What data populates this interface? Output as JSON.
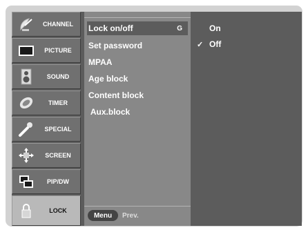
{
  "categories": [
    {
      "label": "CHANNEL",
      "icon": "satellite-dish-icon",
      "selected": false
    },
    {
      "label": "PICTURE",
      "icon": "tv-screen-icon",
      "selected": false
    },
    {
      "label": "SOUND",
      "icon": "speaker-icon",
      "selected": false
    },
    {
      "label": "TIMER",
      "icon": "clock-icon",
      "selected": false
    },
    {
      "label": "SPECIAL",
      "icon": "special-wand-icon",
      "selected": false
    },
    {
      "label": "SCREEN",
      "icon": "screen-arrows-icon",
      "selected": false
    },
    {
      "label": "PIP/DW",
      "icon": "pip-windows-icon",
      "selected": false
    },
    {
      "label": "LOCK",
      "icon": "padlock-icon",
      "selected": true
    }
  ],
  "submenu": {
    "items": [
      {
        "label": "Lock on/off",
        "key": "G",
        "selected": true
      },
      {
        "label": "Set password"
      },
      {
        "label": "MPAA"
      },
      {
        "label": "Age block"
      },
      {
        "label": "Content block"
      },
      {
        "label": " Aux.block"
      }
    ],
    "menu_button": "Menu",
    "prev_label": "Prev."
  },
  "options": {
    "items": [
      {
        "label": "On",
        "checked": false
      },
      {
        "label": "Off",
        "checked": true
      }
    ],
    "check_glyph": "✓"
  },
  "colors": {
    "osd_background": "#5c5c5c",
    "submenu_background": "#888888",
    "category_background": "#707070",
    "category_selected": "#b9b9b9",
    "frame": "#d2d2d2"
  }
}
